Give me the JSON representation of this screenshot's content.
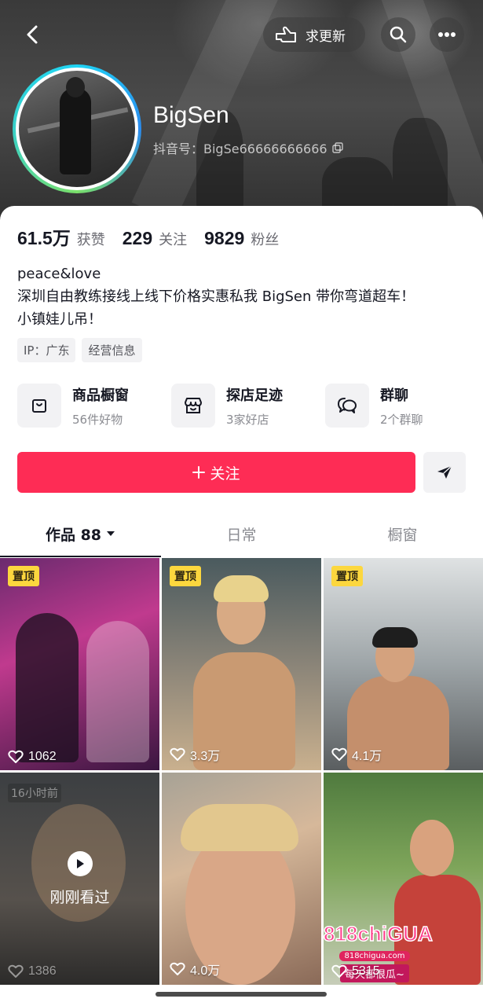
{
  "header": {
    "update_request_label": "求更新",
    "nickname": "BigSen",
    "douyin_id": "抖音号：BigSe66666666666"
  },
  "stats": [
    {
      "value": "61.5万",
      "label": "获赞"
    },
    {
      "value": "229",
      "label": "关注"
    },
    {
      "value": "9829",
      "label": "粉丝"
    }
  ],
  "bio": {
    "line1": "peace&love",
    "line2": "深圳自由教练接线上线下价格实惠私我 BigSen 带你弯道超车！",
    "line3": "小镇娃儿吊！"
  },
  "tags": [
    "IP：广东",
    "经营信息"
  ],
  "features": [
    {
      "title": "商品橱窗",
      "subtitle": "56件好物",
      "icon": "shopping-bag-icon"
    },
    {
      "title": "探店足迹",
      "subtitle": "3家好店",
      "icon": "store-icon"
    },
    {
      "title": "群聊",
      "subtitle": "2个群聊",
      "icon": "chat-bubbles-icon"
    }
  ],
  "follow_label": "关注",
  "tabs": [
    {
      "label": "作品 88",
      "active": true
    },
    {
      "label": "日常",
      "active": false
    },
    {
      "label": "橱窗",
      "active": false
    }
  ],
  "videos": [
    {
      "pinned": true,
      "pin_label": "置顶",
      "likes": "1062"
    },
    {
      "pinned": true,
      "pin_label": "置顶",
      "likes": "3.3万"
    },
    {
      "pinned": true,
      "pin_label": "置顶",
      "likes": "4.1万"
    },
    {
      "time_badge": "16小时前",
      "watched_label": "刚刚看过",
      "likes": "1386"
    },
    {
      "likes": "4.0万"
    },
    {
      "likes": "5315",
      "promo_logo": "818chiGUA",
      "promo_url": "818chigua.com",
      "promo_slogan": "每天都很瓜~"
    }
  ],
  "colors": {
    "follow_button": "#fe2c55",
    "pin_badge": "#fcd73e",
    "text_primary": "#161823",
    "text_secondary": "#8a8b91"
  }
}
